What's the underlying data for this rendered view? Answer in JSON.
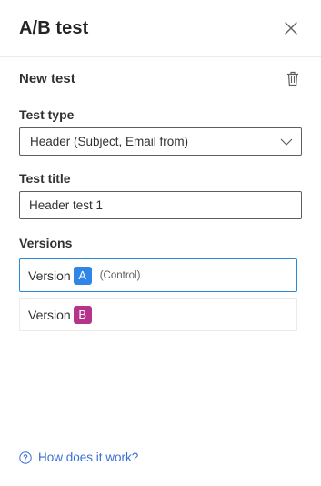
{
  "panel": {
    "title": "A/B test",
    "close_icon": "close-icon"
  },
  "test": {
    "section_title": "New test",
    "delete_icon": "trash-icon"
  },
  "test_type": {
    "label": "Test type",
    "selected": "Header (Subject, Email from)",
    "dropdown_icon": "chevron-down-icon"
  },
  "test_title": {
    "label": "Test title",
    "value": "Header test 1"
  },
  "versions": {
    "label": "Versions",
    "items": [
      {
        "label": "Version",
        "badge": "A",
        "note": "(Control)",
        "badge_color": "#2f86e6",
        "selected": true
      },
      {
        "label": "Version",
        "badge": "B",
        "note": "",
        "badge_color": "#b5338a",
        "selected": false
      }
    ]
  },
  "help": {
    "icon": "question-circle-icon",
    "link_text": "How does it work?"
  },
  "colors": {
    "accent": "#2b88d8",
    "link": "#3b6fd4"
  }
}
